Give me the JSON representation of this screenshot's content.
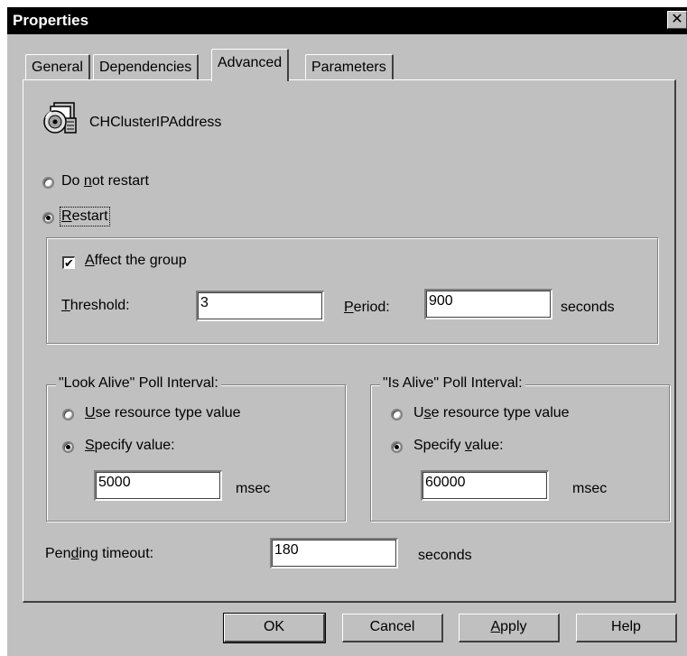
{
  "window": {
    "title": "Properties",
    "close_glyph": "✕"
  },
  "tabs": [
    {
      "label": "General",
      "active": false
    },
    {
      "label": "Dependencies",
      "active": false
    },
    {
      "label": "Advanced",
      "active": true
    },
    {
      "label": "Parameters",
      "active": false
    }
  ],
  "resource": {
    "name": "CHClusterIPAddress",
    "icon": "cluster-resource-icon"
  },
  "restart": {
    "do_not_restart_pre": "Do ",
    "do_not_restart_u": "n",
    "do_not_restart_post": "ot restart",
    "restart_u": "R",
    "restart_post": "estart",
    "selected": "restart"
  },
  "restart_group": {
    "affect_u": "A",
    "affect_post": "ffect the group",
    "affect_checked": true,
    "check_glyph": "✔",
    "threshold_u": "T",
    "threshold_post": "hreshold:",
    "threshold_value": "3",
    "period_u": "P",
    "period_post": "eriod:",
    "period_value": "900",
    "period_unit": "seconds"
  },
  "look_alive": {
    "title": "\"Look Alive\" Poll Interval:",
    "use_type_u": "U",
    "use_type_post": "se resource type value",
    "specify_u": "S",
    "specify_post": "pecify value:",
    "selected": "specify",
    "value": "5000",
    "unit": "msec"
  },
  "is_alive": {
    "title": "\"Is Alive\" Poll Interval:",
    "use_type_pre": "U",
    "use_type_u": "s",
    "use_type_post": "e resource type value",
    "specify_pre": "Specify ",
    "specify_u": "v",
    "specify_post": "alue:",
    "selected": "specify",
    "value": "60000",
    "unit": "msec"
  },
  "pending": {
    "label_pre": "Pen",
    "label_u": "d",
    "label_post": "ing timeout:",
    "value": "180",
    "unit": "seconds"
  },
  "buttons": {
    "ok": "OK",
    "cancel": "Cancel",
    "apply_u": "A",
    "apply_post": "pply",
    "help": "Help"
  },
  "colors": {
    "face": "#c0c0c0",
    "title_bar": "#000000",
    "shadow": "#404040",
    "highlight": "#ffffff"
  }
}
